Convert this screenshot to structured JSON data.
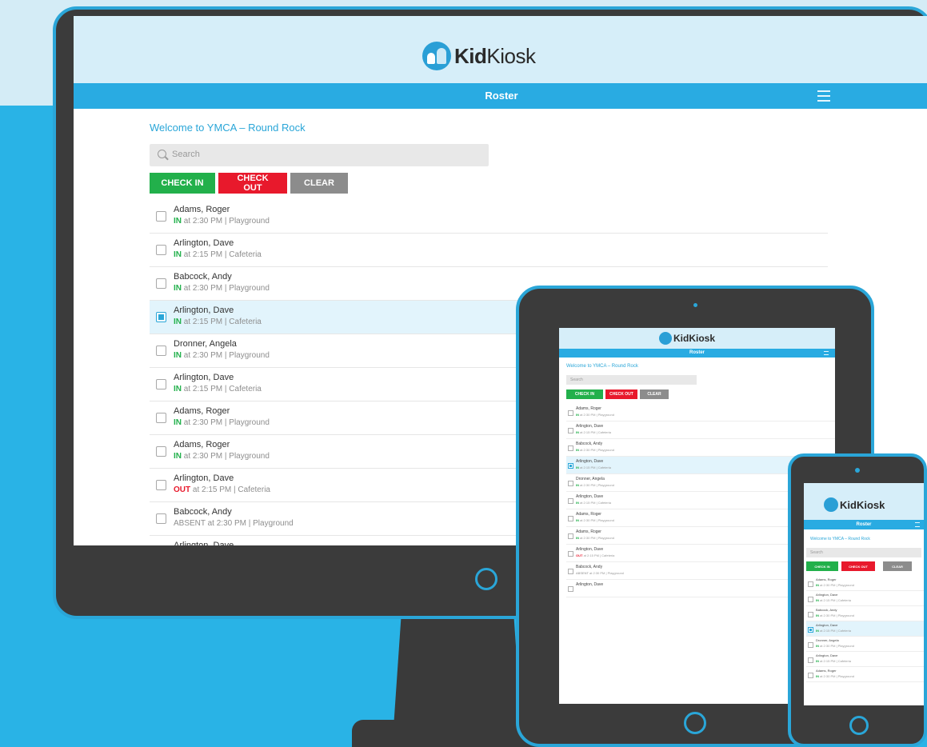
{
  "app": {
    "logo_text_1": "Kid",
    "logo_text_2": "Kiosk",
    "nav_title": "Roster",
    "welcome": "Welcome to YMCA – Round Rock",
    "search_placeholder": "Search",
    "buttons": {
      "check_in": "CHECK IN",
      "check_out": "CHECK OUT",
      "clear": "CLEAR"
    }
  },
  "roster": [
    {
      "name": "Adams, Roger",
      "state": "IN",
      "rest": " at 2:30 PM  |  Playground",
      "checked": false
    },
    {
      "name": "Arlington, Dave",
      "state": "IN",
      "rest": " at 2:15 PM  |  Cafeteria",
      "checked": false
    },
    {
      "name": "Babcock, Andy",
      "state": "IN",
      "rest": " at 2:30 PM  |  Playground",
      "checked": false
    },
    {
      "name": "Arlington, Dave",
      "state": "IN",
      "rest": " at 2:15 PM  |  Cafeteria",
      "checked": true
    },
    {
      "name": "Dronner, Angela",
      "state": "IN",
      "rest": " at 2:30 PM  |  Playground",
      "checked": false
    },
    {
      "name": "Arlington, Dave",
      "state": "IN",
      "rest": " at 2:15 PM  |  Cafeteria",
      "checked": false
    },
    {
      "name": "Adams, Roger",
      "state": "IN",
      "rest": " at 2:30 PM  |  Playground",
      "checked": false
    },
    {
      "name": "Adams, Roger",
      "state": "IN",
      "rest": " at 2:30 PM  |  Playground",
      "checked": false
    },
    {
      "name": "Arlington, Dave",
      "state": "OUT",
      "rest": " at 2:15 PM  |  Cafeteria",
      "checked": false
    },
    {
      "name": "Babcock, Andy",
      "state": "ABSENT",
      "rest": " at 2:30 PM  |  Playground",
      "checked": false
    },
    {
      "name": "Arlington, Dave",
      "state": "",
      "rest": "",
      "checked": false
    }
  ],
  "colors": {
    "brand_blue": "#29abe2",
    "in_green": "#22b04b",
    "out_red": "#e8192c",
    "clear_gray": "#8c8c8c",
    "selected_row": "#e2f4fc"
  }
}
